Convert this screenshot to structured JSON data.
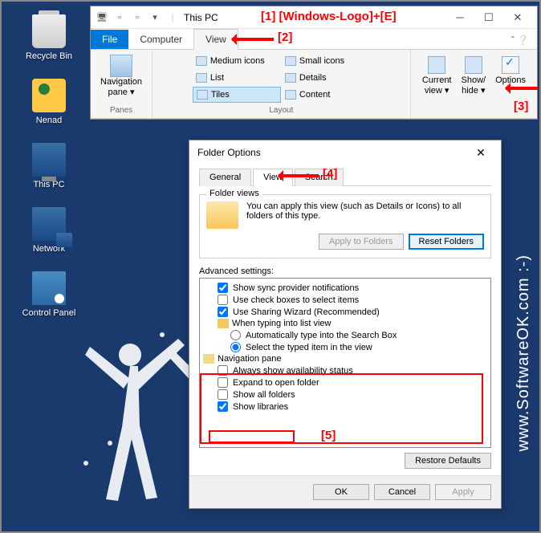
{
  "desktop": {
    "recycle": "Recycle Bin",
    "user": "Nenad",
    "pc": "This PC",
    "network": "Network",
    "cpanel": "Control Panel"
  },
  "explorer": {
    "title": "This PC",
    "tabs": {
      "file": "File",
      "computer": "Computer",
      "view": "View"
    },
    "panes": {
      "nav": "Navigation\npane ▾",
      "group": "Panes"
    },
    "layout": {
      "medium": "Medium icons",
      "small": "Small icons",
      "list": "List",
      "details": "Details",
      "tiles": "Tiles",
      "content": "Content",
      "group": "Layout"
    },
    "right": {
      "current": "Current\nview ▾",
      "showhide": "Show/\nhide ▾",
      "options": "Options"
    }
  },
  "dialog": {
    "title": "Folder Options",
    "tabs": {
      "general": "General",
      "view": "View",
      "search": "Search"
    },
    "folderviews": {
      "title": "Folder views",
      "text": "You can apply this view (such as Details or Icons) to all folders of this type.",
      "apply": "Apply to Folders",
      "reset": "Reset Folders"
    },
    "advanced": {
      "label": "Advanced settings:",
      "items": {
        "sync": "Show sync provider notifications",
        "checkboxes": "Use check boxes to select items",
        "sharing": "Use Sharing Wizard (Recommended)",
        "typing": "When typing into list view",
        "autotype": "Automatically type into the Search Box",
        "selecttyped": "Select the typed item in the view",
        "navpane": "Navigation pane",
        "availability": "Always show availability status",
        "expand": "Expand to open folder",
        "allfolders": "Show all folders",
        "libraries": "Show libraries"
      },
      "restore": "Restore Defaults"
    },
    "buttons": {
      "ok": "OK",
      "cancel": "Cancel",
      "apply": "Apply"
    }
  },
  "annotations": {
    "a1": "[1]  [Windows-Logo]+[E]",
    "a2": "[2]",
    "a3": "[3]",
    "a4": "[4]",
    "a5": "[5]"
  },
  "watermark": "www.SoftwareOK.com :-)"
}
